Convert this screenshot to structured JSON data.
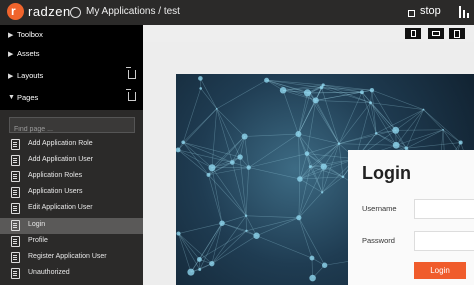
{
  "header": {
    "logo_letter": "r",
    "logo_text": "radzen",
    "breadcrumb": "My Applications / test",
    "stop_label": "stop"
  },
  "sidebar": {
    "sections": [
      {
        "label": "Toolbox",
        "caret": "▶"
      },
      {
        "label": "Assets",
        "caret": "▶"
      },
      {
        "label": "Layouts",
        "caret": "▶"
      },
      {
        "label": "Pages",
        "caret": "▼"
      }
    ],
    "search_placeholder": "Find page ...",
    "pages": [
      {
        "label": "Add Application Role"
      },
      {
        "label": "Add Application User"
      },
      {
        "label": "Application Roles"
      },
      {
        "label": "Application Users"
      },
      {
        "label": "Edit Application User"
      },
      {
        "label": "Login",
        "active": true
      },
      {
        "label": "Profile"
      },
      {
        "label": "Register Application User"
      },
      {
        "label": "Unauthorized"
      }
    ]
  },
  "login": {
    "title": "Login",
    "username_label": "Username",
    "password_label": "Password",
    "button_label": "Login"
  },
  "colors": {
    "accent": "#f05c2c",
    "sidebar_bg": "#2b2a29",
    "section_bg": "#000000"
  }
}
